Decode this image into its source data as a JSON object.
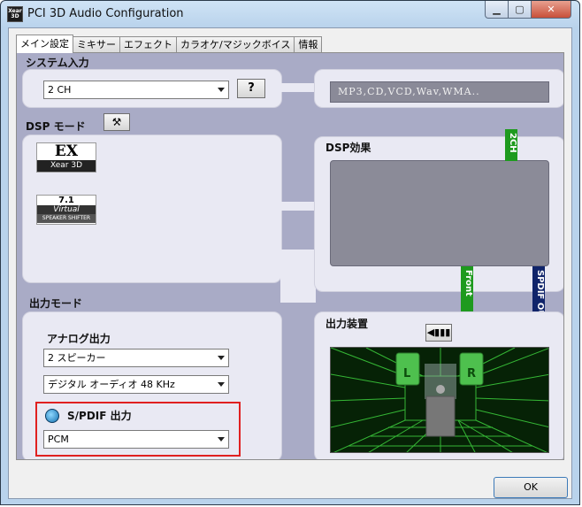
{
  "window": {
    "title": "PCI 3D Audio Configuration",
    "app_icon_text": "Xear 3D"
  },
  "tabs": [
    {
      "label": "メイン設定",
      "active": true
    },
    {
      "label": "ミキサー",
      "active": false
    },
    {
      "label": "エフェクト",
      "active": false
    },
    {
      "label": "カラオケ/マジックボイス",
      "active": false
    },
    {
      "label": "情報",
      "active": false
    }
  ],
  "system_input": {
    "title": "システム入力",
    "selected": "2 CH",
    "help_label": "?",
    "formats": "MP3,CD,VCD,Wav,WMA.."
  },
  "dsp_mode": {
    "title": "DSP モード",
    "ex_logo_top": "EX",
    "ex_logo_bottom": "Xear 3D",
    "vs_logo_l1": "7.1",
    "vs_logo_l2": "Virtual",
    "vs_logo_l3": "SPEAKER SHIFTER"
  },
  "dsp_effect": {
    "title": "DSP効果"
  },
  "signal_bars": {
    "ch2": "2CH",
    "front": "Front",
    "spdif_out": "SPDIF OUT"
  },
  "output_mode": {
    "title": "出力モード",
    "analog_label": "アナログ出力",
    "speakers_selected": "2 スピーカー",
    "digital_selected": "デジタル オーディオ 48 KHz",
    "spdif_label": "S/PDIF 出力",
    "spdif_selected": "PCM"
  },
  "output_device": {
    "title": "出力装置",
    "left_label": "L",
    "right_label": "R"
  },
  "buttons": {
    "ok": "OK"
  },
  "colors": {
    "green_bar": "#1e9a1e",
    "navy_bar": "#10246a",
    "highlight": "#e02020",
    "panel_bg": "#a9abc6"
  }
}
